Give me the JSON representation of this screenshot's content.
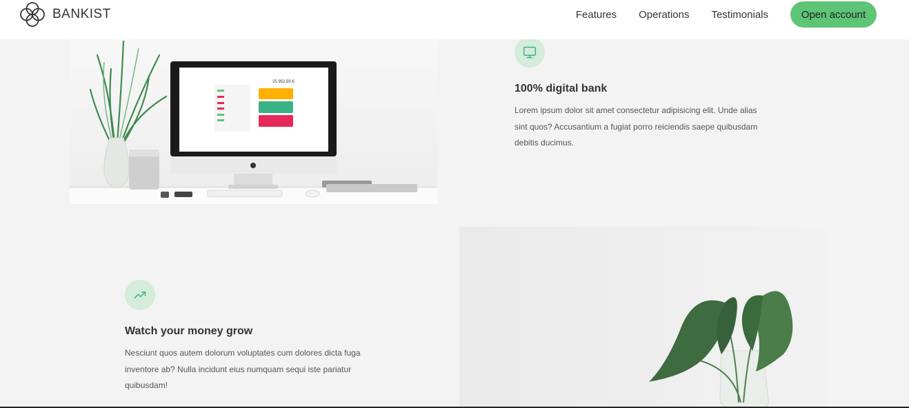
{
  "brand": {
    "name": "BANKIST"
  },
  "nav": {
    "links": [
      "Features",
      "Operations",
      "Testimonials"
    ],
    "cta": "Open account"
  },
  "features": [
    {
      "icon": "monitor-icon",
      "title": "100% digital bank",
      "text": "Lorem ipsum dolor sit amet consectetur adipisicing elit. Unde alias sint quos? Accusantium a fugiat porro reiciendis saepe quibusdam debitis ducimus."
    },
    {
      "icon": "trending-up-icon",
      "title": "Watch your money grow",
      "text": "Nesciunt quos autem dolorum voluptates cum dolores dicta fuga inventore ab? Nulla incidunt eius numquam sequi iste pariatur quibusdam!"
    }
  ],
  "desk_screen": {
    "balance": "25 952,59 €"
  },
  "colors": {
    "accent": "#5ec576",
    "icon_bg": "#d4ecd9",
    "background": "#f3f3f3"
  }
}
